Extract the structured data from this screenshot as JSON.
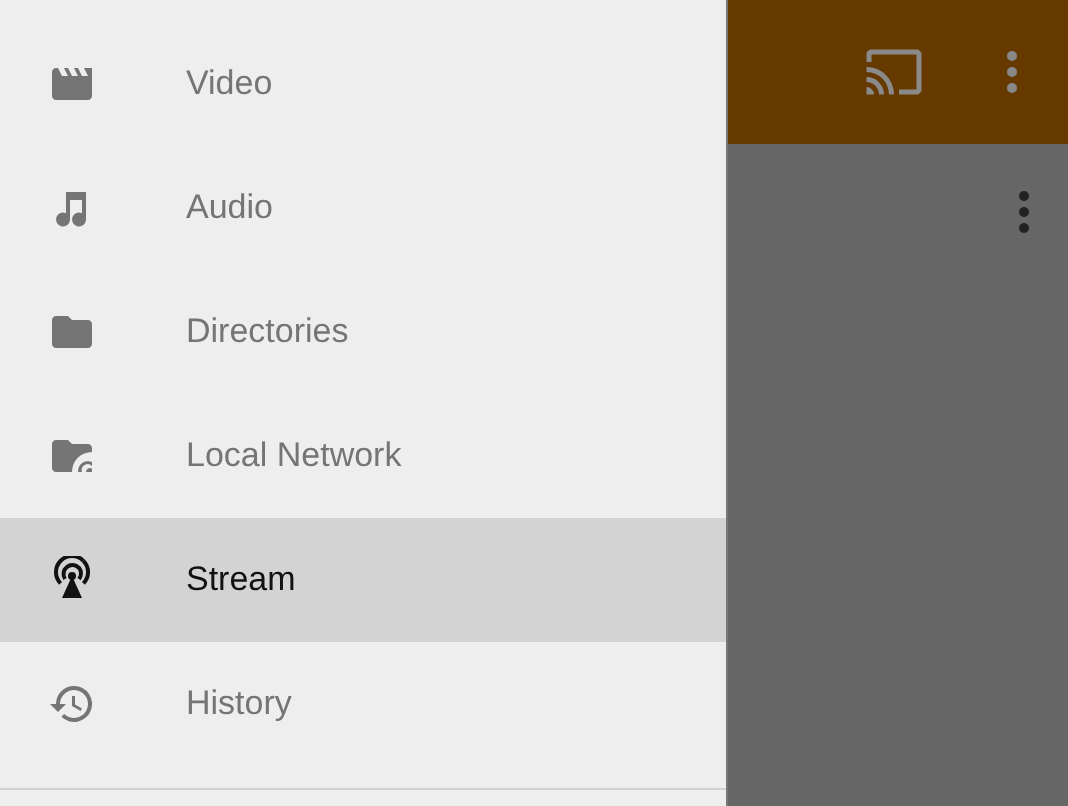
{
  "drawer": {
    "items": [
      {
        "kind": "video",
        "label": "Video",
        "selected": false
      },
      {
        "kind": "audio",
        "label": "Audio",
        "selected": false
      },
      {
        "kind": "folder",
        "label": "Directories",
        "selected": false
      },
      {
        "kind": "network",
        "label": "Local Network",
        "selected": false
      },
      {
        "kind": "stream",
        "label": "Stream",
        "selected": true
      },
      {
        "kind": "history",
        "label": "History",
        "selected": false
      }
    ]
  }
}
